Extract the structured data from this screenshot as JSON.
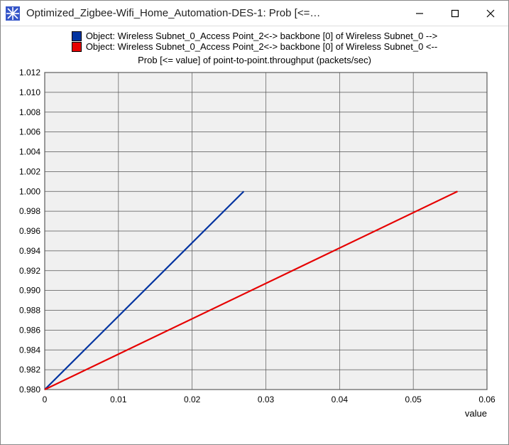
{
  "window": {
    "title": "Optimized_Zigbee-Wifi_Home_Automation-DES-1: Prob [<=…"
  },
  "legend": {
    "series1": "Object: Wireless Subnet_0_Access Point_2<-> backbone [0] of Wireless Subnet_0 -->",
    "series2": "Object: Wireless Subnet_0_Access Point_2<-> backbone [0] of Wireless Subnet_0 <--"
  },
  "colors": {
    "series1": "#0033a0",
    "series2": "#e60000",
    "plot_bg": "#f0f0f0",
    "grid": "#555"
  },
  "chart_data": {
    "type": "line",
    "title": "Prob [<= value] of point-to-point.throughput (packets/sec)",
    "xlabel": "value",
    "ylabel": "",
    "xlim": [
      0,
      0.06
    ],
    "ylim": [
      0.98,
      1.012
    ],
    "xticks": [
      0,
      0.01,
      0.02,
      0.03,
      0.04,
      0.05,
      0.06
    ],
    "yticks": [
      0.98,
      0.982,
      0.984,
      0.986,
      0.988,
      0.99,
      0.992,
      0.994,
      0.996,
      0.998,
      1.0,
      1.002,
      1.004,
      1.006,
      1.008,
      1.01,
      1.012
    ],
    "series": [
      {
        "name": "Object: Wireless Subnet_0_Access Point_2<-> backbone [0] of Wireless Subnet_0 -->",
        "color": "#0033a0",
        "x": [
          0,
          0.027
        ],
        "values": [
          0.98,
          1.0
        ]
      },
      {
        "name": "Object: Wireless Subnet_0_Access Point_2<-> backbone [0] of Wireless Subnet_0 <--",
        "color": "#e60000",
        "x": [
          0,
          0.056
        ],
        "values": [
          0.98,
          1.0
        ]
      }
    ]
  },
  "xtick_labels": {
    "t0": "0",
    "t1": "0.01",
    "t2": "0.02",
    "t3": "0.03",
    "t4": "0.04",
    "t5": "0.05",
    "t6": "0.06"
  },
  "ytick_labels": {
    "y0": "0.980",
    "y1": "0.982",
    "y2": "0.984",
    "y3": "0.986",
    "y4": "0.988",
    "y5": "0.990",
    "y6": "0.992",
    "y7": "0.994",
    "y8": "0.996",
    "y9": "0.998",
    "y10": "1.000",
    "y11": "1.002",
    "y12": "1.004",
    "y13": "1.006",
    "y14": "1.008",
    "y15": "1.010",
    "y16": "1.012"
  }
}
